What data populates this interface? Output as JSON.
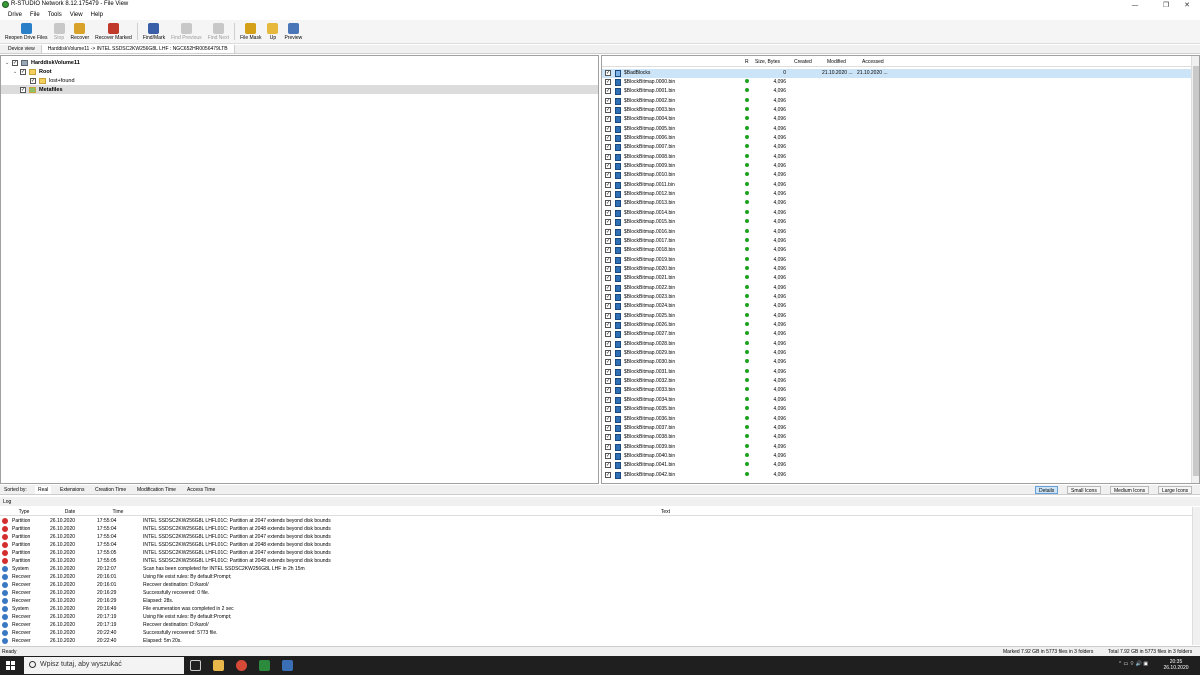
{
  "window": {
    "title": "R-STUDIO Network 8.12.175479 - File View",
    "minimize": "—",
    "maximize": "❐",
    "close": "✕"
  },
  "menu": [
    "Drive",
    "File",
    "Tools",
    "View",
    "Help"
  ],
  "toolbar": [
    {
      "label": "Reopen Drive Files",
      "icon": "reopen-icon",
      "color": "#2a7fc9",
      "enabled": true
    },
    {
      "label": "Stop",
      "icon": "stop-icon",
      "color": "#888888",
      "enabled": false
    },
    {
      "label": "Recover",
      "icon": "recover-icon",
      "color": "#d9a22b",
      "enabled": true
    },
    {
      "label": "Recover Marked",
      "icon": "recover-marked-icon",
      "color": "#c0392b",
      "enabled": true
    },
    {
      "label": "Find/Mark",
      "icon": "binoculars-icon",
      "color": "#3b5ea8",
      "enabled": true
    },
    {
      "label": "Find Previous",
      "icon": "find-previous-icon",
      "color": "#999999",
      "enabled": false
    },
    {
      "label": "Find Next",
      "icon": "find-next-icon",
      "color": "#999999",
      "enabled": false
    },
    {
      "label": "File Mask",
      "icon": "file-mask-icon",
      "color": "#d4a017",
      "enabled": true
    },
    {
      "label": "Up",
      "icon": "folder-up-icon",
      "color": "#e6b93c",
      "enabled": true
    },
    {
      "label": "Preview",
      "icon": "preview-icon",
      "color": "#4a76b8",
      "enabled": true
    }
  ],
  "tabs": [
    {
      "label": "Device view"
    },
    {
      "label": "HarddiskVolume11 -> INTEL SSDSC2KW256G8L LHF : NGC652HR0056479LTB"
    }
  ],
  "tree": [
    {
      "label": "HarddiskVolume11",
      "bold": true,
      "expander": "⌄",
      "checked": true,
      "folder": false,
      "selected": false
    },
    {
      "label": "Root",
      "bold": true,
      "expander": "⌄",
      "checked": true,
      "folder": true,
      "selected": false
    },
    {
      "label": "lost+found",
      "bold": false,
      "expander": "",
      "checked": true,
      "folder": true,
      "selected": false
    },
    {
      "label": "Metafiles",
      "bold": true,
      "expander": "",
      "checked": true,
      "folder": true,
      "selected": true
    }
  ],
  "files": {
    "columns": {
      "r": "R",
      "size": "Size, Bytes",
      "created": "Created",
      "modified": "Modified",
      "accessed": "Accessed"
    },
    "first": {
      "name": "$BadBlocks",
      "size": "0",
      "modified": "21.10.2020 ...",
      "accessed": "21.10.2020 ..."
    },
    "rows": [
      "$BlockBitmap.0000.bin",
      "$BlockBitmap.0001.bin",
      "$BlockBitmap.0002.bin",
      "$BlockBitmap.0003.bin",
      "$BlockBitmap.0004.bin",
      "$BlockBitmap.0005.bin",
      "$BlockBitmap.0006.bin",
      "$BlockBitmap.0007.bin",
      "$BlockBitmap.0008.bin",
      "$BlockBitmap.0009.bin",
      "$BlockBitmap.0010.bin",
      "$BlockBitmap.0011.bin",
      "$BlockBitmap.0012.bin",
      "$BlockBitmap.0013.bin",
      "$BlockBitmap.0014.bin",
      "$BlockBitmap.0015.bin",
      "$BlockBitmap.0016.bin",
      "$BlockBitmap.0017.bin",
      "$BlockBitmap.0018.bin",
      "$BlockBitmap.0019.bin",
      "$BlockBitmap.0020.bin",
      "$BlockBitmap.0021.bin",
      "$BlockBitmap.0022.bin",
      "$BlockBitmap.0023.bin",
      "$BlockBitmap.0024.bin",
      "$BlockBitmap.0025.bin",
      "$BlockBitmap.0026.bin",
      "$BlockBitmap.0027.bin",
      "$BlockBitmap.0028.bin",
      "$BlockBitmap.0029.bin",
      "$BlockBitmap.0030.bin",
      "$BlockBitmap.0031.bin",
      "$BlockBitmap.0032.bin",
      "$BlockBitmap.0033.bin",
      "$BlockBitmap.0034.bin",
      "$BlockBitmap.0035.bin",
      "$BlockBitmap.0036.bin",
      "$BlockBitmap.0037.bin",
      "$BlockBitmap.0038.bin",
      "$BlockBitmap.0039.bin",
      "$BlockBitmap.0040.bin",
      "$BlockBitmap.0041.bin",
      "$BlockBitmap.0042.bin"
    ],
    "row_size": "4,096"
  },
  "sortbar": {
    "label": "Sorted by:",
    "options": [
      "Real",
      "Extensions",
      "Creation Time",
      "Modification Time",
      "Access Time"
    ],
    "active": "Real",
    "views": [
      "Details",
      "Small Icons",
      "Medium Icons",
      "Large Icons"
    ],
    "active_view": "Details"
  },
  "log": {
    "title": "Log",
    "columns": {
      "type": "Type",
      "date": "Date",
      "time": "Time",
      "text": "Text"
    },
    "rows": [
      {
        "type": "Partition",
        "date": "26.10.2020",
        "time": "17:55:04",
        "text": "INTEL SSDSC2KW256G8L LHFL01C: Partition at 2047 extends beyond disk bounds",
        "level": "error"
      },
      {
        "type": "Partition",
        "date": "26.10.2020",
        "time": "17:55:04",
        "text": "INTEL SSDSC2KW256G8L LHFL01C: Partition at 2048 extends beyond disk bounds",
        "level": "error"
      },
      {
        "type": "Partition",
        "date": "26.10.2020",
        "time": "17:55:04",
        "text": "INTEL SSDSC2KW256G8L LHFL01C: Partition at 2047 extends beyond disk bounds",
        "level": "error"
      },
      {
        "type": "Partition",
        "date": "26.10.2020",
        "time": "17:55:04",
        "text": "INTEL SSDSC2KW256G8L LHFL01C: Partition at 2048 extends beyond disk bounds",
        "level": "error"
      },
      {
        "type": "Partition",
        "date": "26.10.2020",
        "time": "17:55:05",
        "text": "INTEL SSDSC2KW256G8L LHFL01C: Partition at 2047 extends beyond disk bounds",
        "level": "error"
      },
      {
        "type": "Partition",
        "date": "26.10.2020",
        "time": "17:55:05",
        "text": "INTEL SSDSC2KW256G8L LHFL01C: Partition at 2048 extends beyond disk bounds",
        "level": "error"
      },
      {
        "type": "System",
        "date": "26.10.2020",
        "time": "20:12:07",
        "text": "Scan has been completed for INTEL SSDSC2KW256G8L LHF in 2h 15m",
        "level": "info"
      },
      {
        "type": "Recover",
        "date": "26.10.2020",
        "time": "20:16:01",
        "text": "Using file exist rules: By default:Prompt;",
        "level": "info"
      },
      {
        "type": "Recover",
        "date": "26.10.2020",
        "time": "20:16:01",
        "text": "Recover destination: D:/karol/",
        "level": "info"
      },
      {
        "type": "Recover",
        "date": "26.10.2020",
        "time": "20:16:29",
        "text": "Successfully recovered: 0 file.",
        "level": "info"
      },
      {
        "type": "Recover",
        "date": "26.10.2020",
        "time": "20:16:29",
        "text": "Elapsed: 28s.",
        "level": "info"
      },
      {
        "type": "System",
        "date": "26.10.2020",
        "time": "20:16:49",
        "text": "File enumeration was completed in 2 sec",
        "level": "info"
      },
      {
        "type": "Recover",
        "date": "26.10.2020",
        "time": "20:17:19",
        "text": "Using file exist rules: By default:Prompt;",
        "level": "info"
      },
      {
        "type": "Recover",
        "date": "26.10.2020",
        "time": "20:17:19",
        "text": "Recover destination: D:/karol/",
        "level": "info"
      },
      {
        "type": "Recover",
        "date": "26.10.2020",
        "time": "20:22:40",
        "text": "Successfully recovered: 5773 file.",
        "level": "info"
      },
      {
        "type": "Recover",
        "date": "26.10.2020",
        "time": "20:22:40",
        "text": "Elapsed: 5m 20s.",
        "level": "info"
      }
    ]
  },
  "status": {
    "left": "Ready",
    "marked": "Marked 7.92 GB in 5773 files in 3 folders",
    "total": "Total 7.92 GB in 5773 files in 3 folders"
  },
  "taskbar": {
    "search_placeholder": "Wpisz tutaj, aby wyszukać",
    "time": "20:35",
    "date": "26.10.2020",
    "tray_icons": "⌃ ▭ ⌔ 🔊 ▣"
  },
  "colors": {
    "error": "#d32f2f",
    "info": "#3a78c3",
    "ok": "#1fa31f",
    "selection": "#cce4f7"
  }
}
